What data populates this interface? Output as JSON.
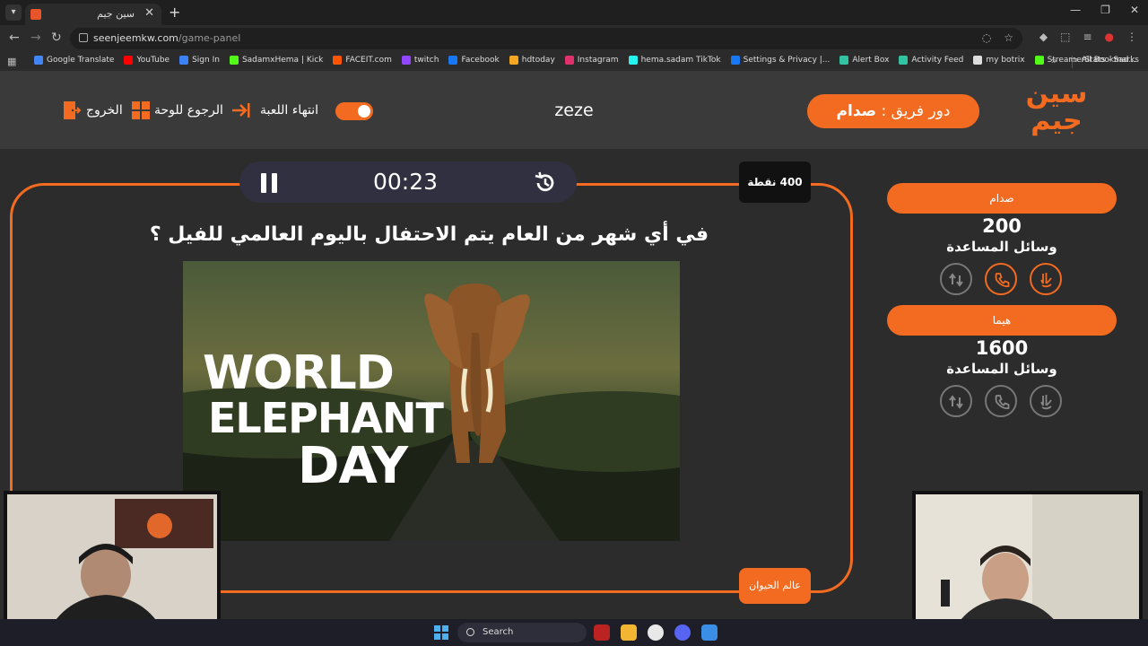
{
  "browser": {
    "tab_title": "سين جيم",
    "tab_close": "✕",
    "new_tab": "+",
    "url_domain": "seenjeemkw.com",
    "url_path": "/game-panel",
    "bookmarks": [
      {
        "label": "Google Translate",
        "color": "#4285f4"
      },
      {
        "label": "YouTube",
        "color": "#ff0000"
      },
      {
        "label": "Sign In",
        "color": "#3b82f6"
      },
      {
        "label": "SadamxHema | Kick",
        "color": "#53fc18"
      },
      {
        "label": "FACEIT.com",
        "color": "#ff5500"
      },
      {
        "label": "twitch",
        "color": "#9146ff"
      },
      {
        "label": "Facebook",
        "color": "#1877f2"
      },
      {
        "label": "hdtoday",
        "color": "#f5a623"
      },
      {
        "label": "Instagram",
        "color": "#e1306c"
      },
      {
        "label": "hema.sadam TikTok",
        "color": "#25f4ee"
      },
      {
        "label": "Settings & Privacy |...",
        "color": "#1877f2"
      },
      {
        "label": "Alert Box",
        "color": "#31c3a2"
      },
      {
        "label": "Activity Feed",
        "color": "#31c3a2"
      },
      {
        "label": "my botrix",
        "color": "#dddddd"
      },
      {
        "label": "StreamerStats - Sad...",
        "color": "#53fc18"
      }
    ],
    "bookmarks_more": "»",
    "all_bookmarks": "All Bookmarks"
  },
  "header": {
    "logo_text": "سين جيم",
    "turn_prefix": "دور فريق :",
    "turn_team": "صدام",
    "game_name": "zeze",
    "end_game": "انتهاء اللعبة",
    "back_to_board": "الرجوع للوحة",
    "exit": "الخروج"
  },
  "question_panel": {
    "timer": "00:23",
    "points": "400 نقطة",
    "question": "في أي شهر من العام يتم الاحتفال باليوم العالمي للفيل ؟",
    "image_text": [
      "WORLD",
      "ELEPHANT",
      "DAY"
    ],
    "category": "عالم الحيوان"
  },
  "teams": [
    {
      "name": "صدام",
      "score": "200",
      "aids_label": "وسائل المساعدة",
      "aids_active": [
        false,
        true,
        true
      ]
    },
    {
      "name": "هيما",
      "score": "1600",
      "aids_label": "وسائل المساعدة",
      "aids_active": [
        false,
        false,
        false
      ]
    }
  ],
  "taskbar": {
    "search_label": "Search"
  },
  "colors": {
    "accent": "#f26b21",
    "background": "#2c2c2c",
    "header": "#3a3a3a"
  }
}
